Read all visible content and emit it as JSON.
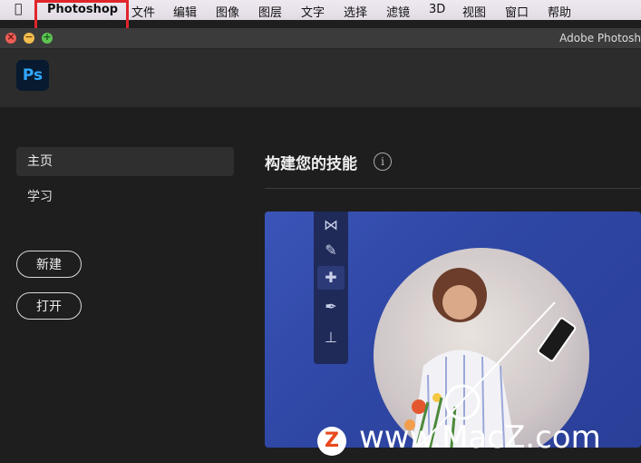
{
  "menubar": {
    "apple_icon": "apple-icon",
    "app_name": "Photoshop",
    "items": [
      "文件",
      "编辑",
      "图像",
      "图层",
      "文字",
      "选择",
      "滤镜",
      "3D",
      "视图",
      "窗口",
      "帮助"
    ]
  },
  "window": {
    "title": "Adobe Photosh",
    "controls": {
      "close": "×",
      "minimize": "−",
      "maximize": "+"
    }
  },
  "app": {
    "logo_text": "Ps"
  },
  "sidebar": {
    "home_label": "主页",
    "learn_label": "学习",
    "new_label": "新建",
    "open_label": "打开"
  },
  "content": {
    "heading": "构建您的技能",
    "info_icon": "i"
  },
  "banner": {
    "tools": [
      "⋈",
      "✎",
      "✚",
      "✒",
      "⊥"
    ]
  },
  "watermark": {
    "badge": "Z",
    "text": "www.MacZ.com"
  },
  "colors": {
    "accent_ps": "#31a8ff",
    "highlight": "#e0262b",
    "banner_blue": "#2f47a5"
  }
}
